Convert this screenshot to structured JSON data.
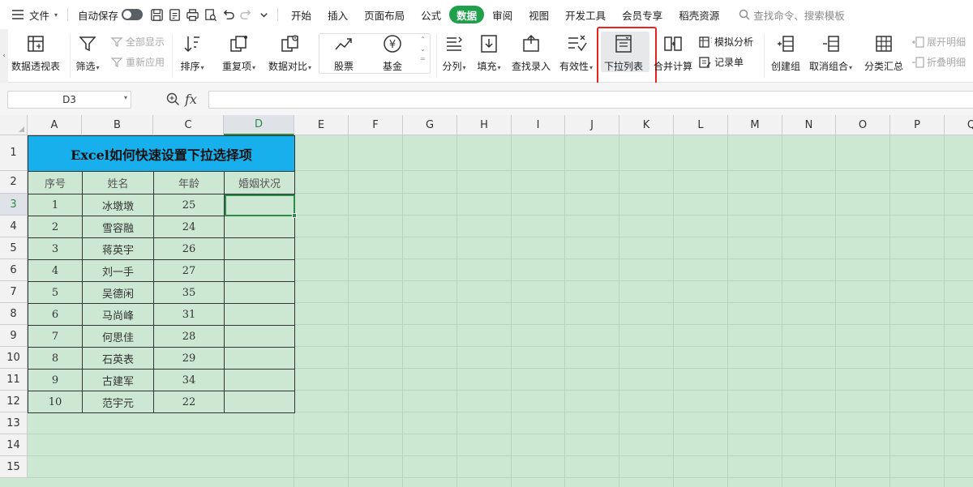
{
  "menubar": {
    "file_label": "文件",
    "autosave_label": "自动保存",
    "tabs": [
      "开始",
      "插入",
      "页面布局",
      "公式",
      "数据",
      "审阅",
      "视图",
      "开发工具",
      "会员专享",
      "稻壳资源"
    ],
    "active_tab": "数据",
    "search_placeholder": "查找命令、搜索模板"
  },
  "ribbon": {
    "pivot": "数据透视表",
    "filter": "筛选",
    "show_all": "全部显示",
    "reapply": "重新应用",
    "sort": "排序",
    "duplicates": "重复项",
    "compare": "数据对比",
    "stocks": "股票",
    "funds": "基金",
    "split": "分列",
    "fill": "填充",
    "lookup_entry": "查找录入",
    "validity": "有效性",
    "dropdown_list": "下拉列表",
    "consolidate": "合并计算",
    "what_if": "模拟分析",
    "record_form": "记录单",
    "create_group": "创建组",
    "ungroup": "取消组合",
    "subtotal": "分类汇总",
    "expand_detail": "展开明细",
    "collapse_detail": "折叠明细"
  },
  "formula_bar": {
    "cell_ref": "D3",
    "content": ""
  },
  "sheet": {
    "columns": [
      "A",
      "B",
      "C",
      "D",
      "E",
      "F",
      "G",
      "H",
      "I",
      "J",
      "K",
      "L",
      "M",
      "N",
      "O",
      "P",
      "Q"
    ],
    "rows": [
      "1",
      "2",
      "3",
      "4",
      "5",
      "6",
      "7",
      "8",
      "9",
      "10",
      "11",
      "12",
      "13",
      "14",
      "15"
    ],
    "selected_column": "D",
    "selected_row": "3",
    "title": "Excel如何快速设置下拉选择项",
    "headers": [
      "序号",
      "姓名",
      "年龄",
      "婚姻状况"
    ],
    "records": [
      [
        "1",
        "冰墩墩",
        "25",
        ""
      ],
      [
        "2",
        "雪容融",
        "24",
        ""
      ],
      [
        "3",
        "蒋英宇",
        "26",
        ""
      ],
      [
        "4",
        "刘一手",
        "27",
        ""
      ],
      [
        "5",
        "吴德闲",
        "35",
        ""
      ],
      [
        "6",
        "马尚峰",
        "31",
        ""
      ],
      [
        "7",
        "何思佳",
        "28",
        ""
      ],
      [
        "8",
        "石英表",
        "29",
        ""
      ],
      [
        "9",
        "古建军",
        "34",
        ""
      ],
      [
        "10",
        "范宇元",
        "22",
        ""
      ]
    ]
  },
  "colors": {
    "accent": "#1fa04a",
    "title_fill": "#17b0ec",
    "sheet_bg": "#cde8d2",
    "highlight_box": "#e8231e"
  }
}
